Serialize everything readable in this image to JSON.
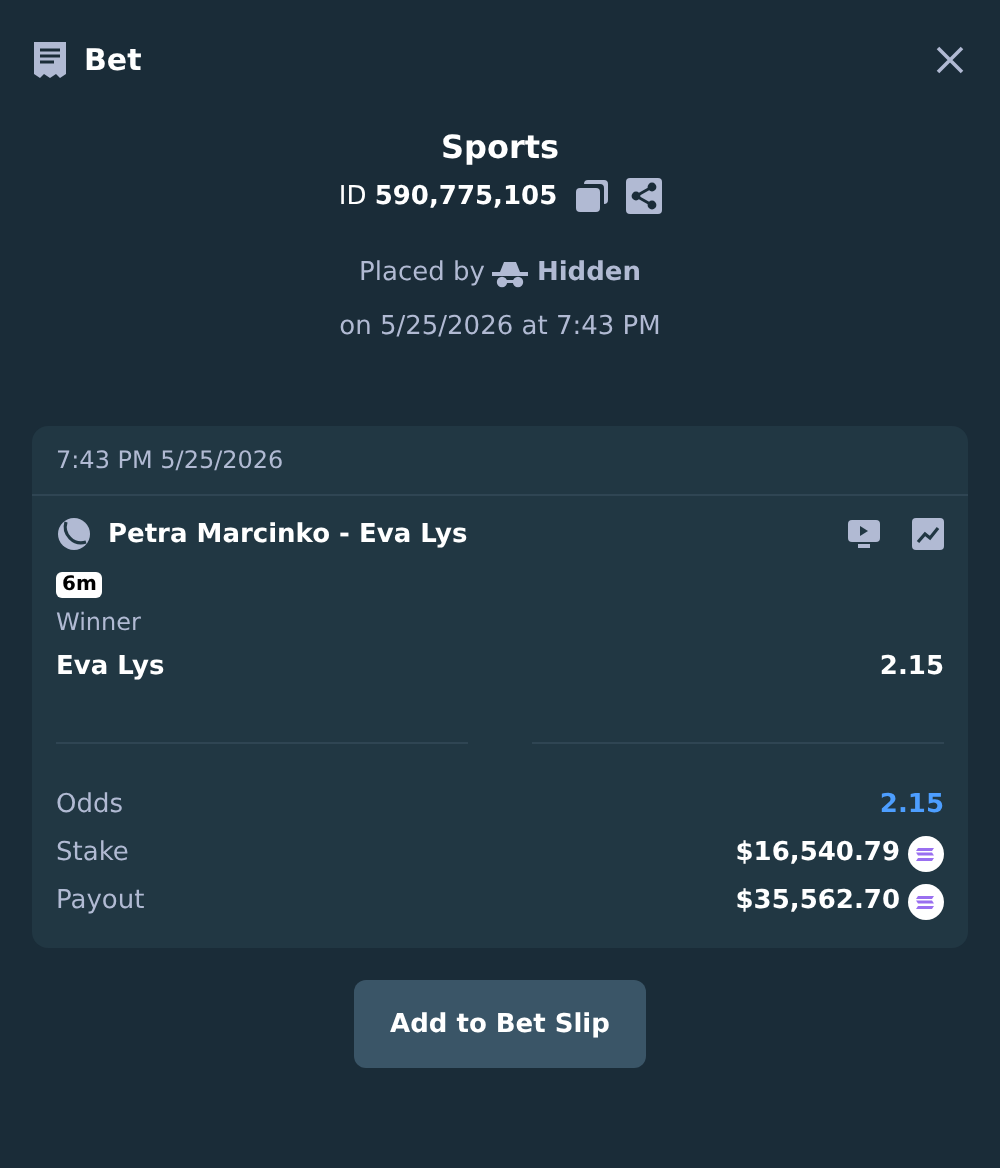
{
  "header": {
    "title": "Bet"
  },
  "summary": {
    "category": "Sports",
    "bet_id": "ID **590,775,105**",
    "placed_by_label": "Placed by",
    "placed_by_user": "Hidden",
    "placed_on": "on 5/25/2026 at 7:43 PM"
  },
  "card": {
    "timestamp": "7:43 PM 5/25/2026",
    "event": "Petra Marcinko - Eva Lys",
    "live_badge": "6m",
    "market": "Winner",
    "selection": "Eva Lys",
    "selection_odds": "2.15",
    "stats": [
      {
        "kind": "odds",
        "label": "Odds",
        "value": "2.15"
      },
      {
        "kind": "amount",
        "label": "Stake",
        "value": "$16,540.79"
      },
      {
        "kind": "amount",
        "label": "Payout",
        "value": "$35,562.70"
      }
    ]
  },
  "buttons": [
    "Add to Bet Slip"
  ]
}
